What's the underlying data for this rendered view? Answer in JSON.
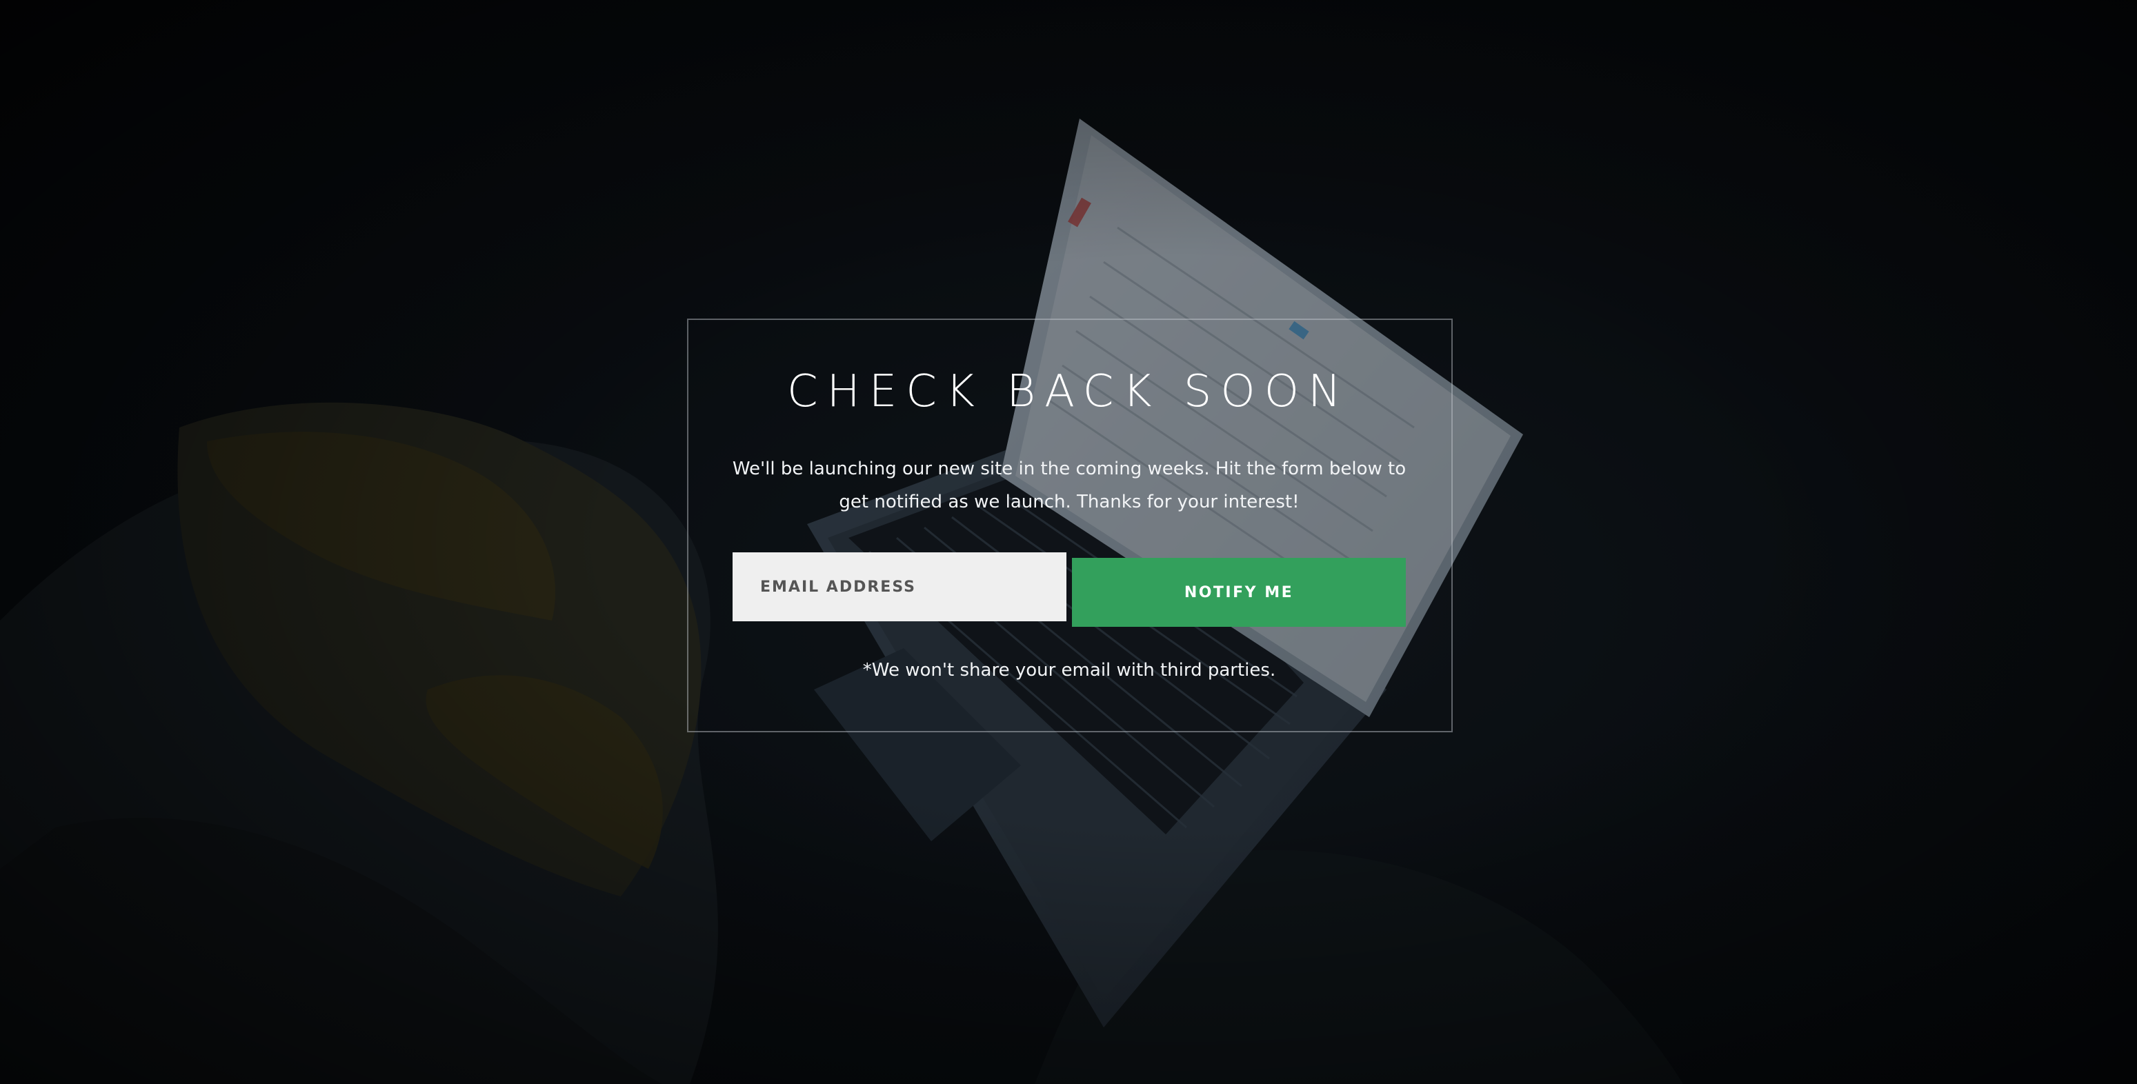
{
  "hero": {
    "title": "CHECK BACK SOON",
    "description": "We'll be launching our new site in the coming weeks. Hit the form below to get notified as we launch. Thanks for your interest!",
    "disclaimer": "*We won't share your email with third parties."
  },
  "signup_form": {
    "email_placeholder": "EMAIL ADDRESS",
    "email_value": "",
    "submit_label": "NOTIFY ME"
  },
  "colors": {
    "page_background": "#080b0e",
    "button_green": "#33a05c",
    "field_background": "#efefef",
    "card_border": "#c8cdd2",
    "text": "#ffffff"
  },
  "background_image": {
    "icons": [
      "laptop-illustration",
      "bedsheet-illustration"
    ]
  }
}
